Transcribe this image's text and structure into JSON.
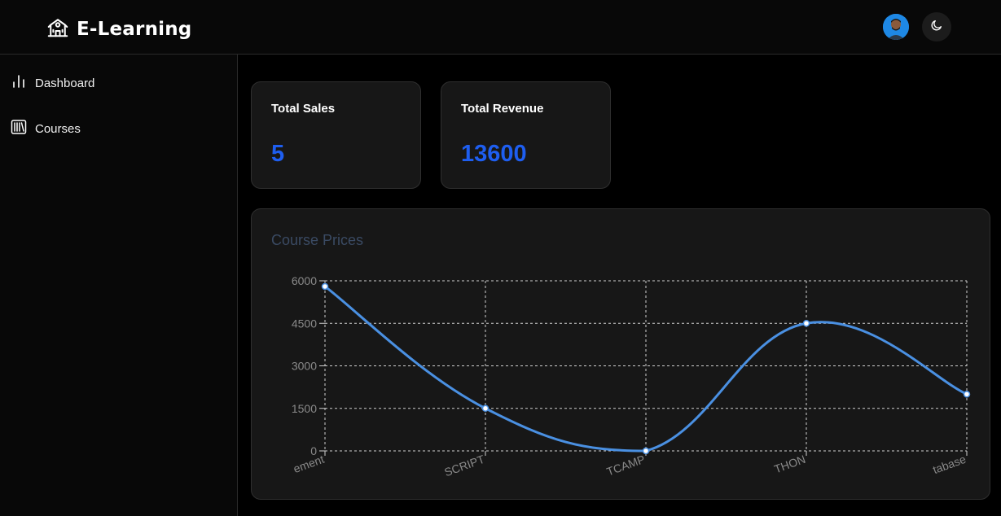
{
  "app": {
    "title": "E-Learning",
    "logo_icon": "school-building-icon",
    "avatar_icon": "user-avatar",
    "theme_toggle_icon": "moon-icon"
  },
  "sidebar": {
    "items": [
      {
        "label": "Dashboard",
        "icon": "bar-chart-icon"
      },
      {
        "label": "Courses",
        "icon": "library-icon"
      }
    ]
  },
  "stats": {
    "total_sales": {
      "label": "Total Sales",
      "value": "5"
    },
    "total_revenue": {
      "label": "Total Revenue",
      "value": "13600"
    }
  },
  "colors": {
    "accent": "#1e5ef0",
    "line": "#4a90e2",
    "card_bg": "#171717",
    "chart_title": "#3a4a63"
  },
  "chart_data": {
    "type": "line",
    "title": "Course Prices",
    "categories": [
      "ement",
      "SCRIPT",
      "TCAMP",
      "THON",
      "tabase"
    ],
    "series": [
      {
        "values": [
          5800,
          1500,
          0,
          4500,
          2000
        ]
      }
    ],
    "ylim": [
      0,
      6000
    ],
    "yticks": [
      "0",
      "1500",
      "3000",
      "4500",
      "6000"
    ],
    "grid": true,
    "smooth": true
  }
}
